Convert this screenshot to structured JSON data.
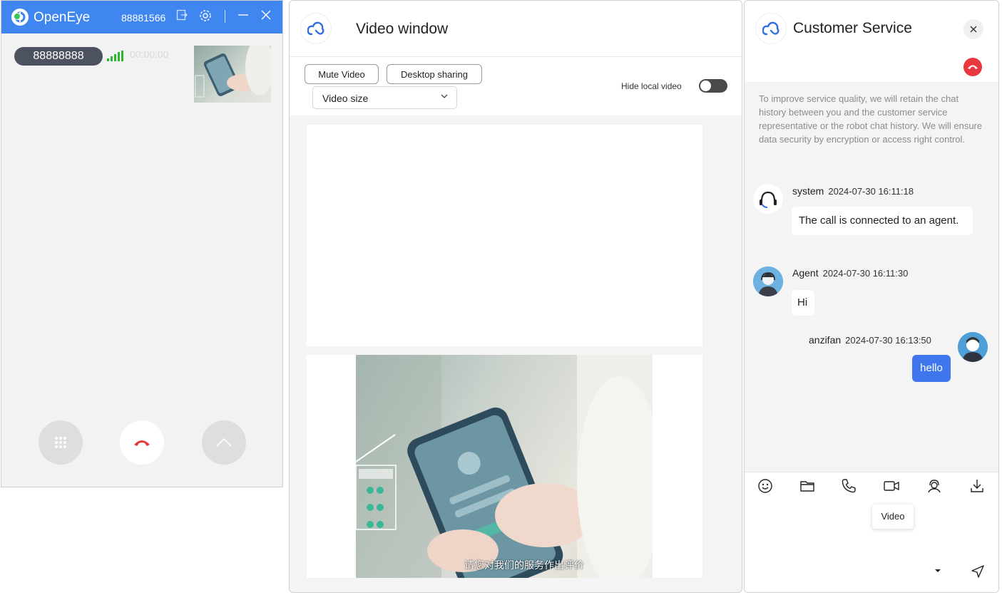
{
  "openeye": {
    "title": "OpenEye",
    "account_number": "88881566",
    "caller_number": "88888888",
    "call_timer": "00:00:00",
    "icons": [
      "logo-icon",
      "logout-icon",
      "settings-icon",
      "minimize-icon",
      "close-icon",
      "signal-icon",
      "dialpad-icon",
      "hangup-icon",
      "expand-icon"
    ],
    "colors": {
      "titlebar": "#3f86f0",
      "hangup": "#e8383d",
      "signal": "#2fb52f"
    }
  },
  "video_window": {
    "title": "Video window",
    "mute_video_label": "Mute Video",
    "desktop_sharing_label": "Desktop sharing",
    "video_size_placeholder": "Video size",
    "hide_local_video_label": "Hide local video",
    "hide_local_video_on": false,
    "subtitle": "请您对我们的服务作出评价"
  },
  "customer_service": {
    "title": "Customer Service",
    "privacy_notice": "To improve service quality, we will retain the chat history between you and the customer service representative or the robot chat history. We will ensure data security by encryption or access right control.",
    "messages": [
      {
        "sender": "system",
        "time": "2024-07-30 16:11:18",
        "text": "The call is connected to an agent."
      },
      {
        "sender": "Agent",
        "time": "2024-07-30 16:11:30",
        "text": "Hi"
      },
      {
        "sender": "anzifan",
        "time": "2024-07-30 16:13:50",
        "text": "hello"
      }
    ],
    "toolbar_icons": [
      "emoji-icon",
      "folder-icon",
      "phone-icon",
      "video-icon",
      "agent-icon",
      "download-icon"
    ],
    "tooltip": "Video",
    "colors": {
      "user_bubble": "#3f76ee",
      "hangup": "#e8383d"
    }
  }
}
